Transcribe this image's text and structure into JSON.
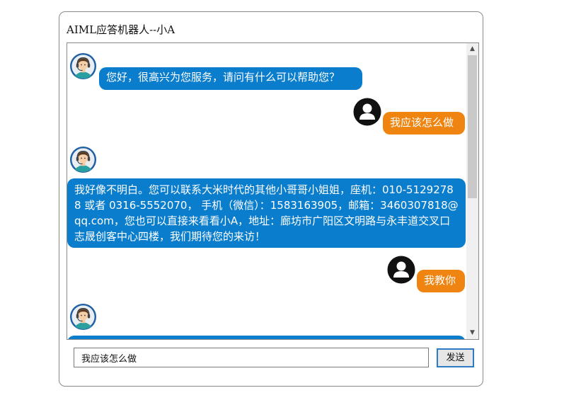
{
  "window": {
    "title": "AIML应答机器人--小A"
  },
  "chat": {
    "messages": [
      {
        "sender": "bot",
        "avatar_icon": "agent-headset-avatar-icon",
        "text": "您好，很高兴为您服务，请问有什么可以帮助您？"
      },
      {
        "sender": "user",
        "avatar_icon": "user-avatar-icon",
        "text": "我应该怎么做"
      },
      {
        "sender": "bot",
        "avatar_icon": "agent-headset-avatar-icon",
        "text": "我好像不明白。您可以联系大米时代的其他小哥哥小姐姐，座机：010-51292788 或者 0316-5552070， 手机（微信）：1583163905，邮箱：3460307818@qq.com，您也可以直接来看看小A，地址：廊坊市广阳区文明路与永丰道交叉口志晟创客中心四楼，我们期待您的来访！"
      },
      {
        "sender": "user",
        "avatar_icon": "user-avatar-icon",
        "text": "我教你"
      },
      {
        "sender": "bot",
        "avatar_icon": "agent-headset-avatar-icon",
        "text": ""
      }
    ]
  },
  "composer": {
    "input_value": "我应该怎么做",
    "send_label": "发送"
  },
  "scrollbar": {
    "up_icon": "scroll-up-arrow-icon",
    "down_icon": "scroll-down-arrow-icon"
  },
  "colors": {
    "bot_bubble": "#0a7dcd",
    "user_bubble": "#ef8411",
    "send_border": "#2c7bc4"
  }
}
